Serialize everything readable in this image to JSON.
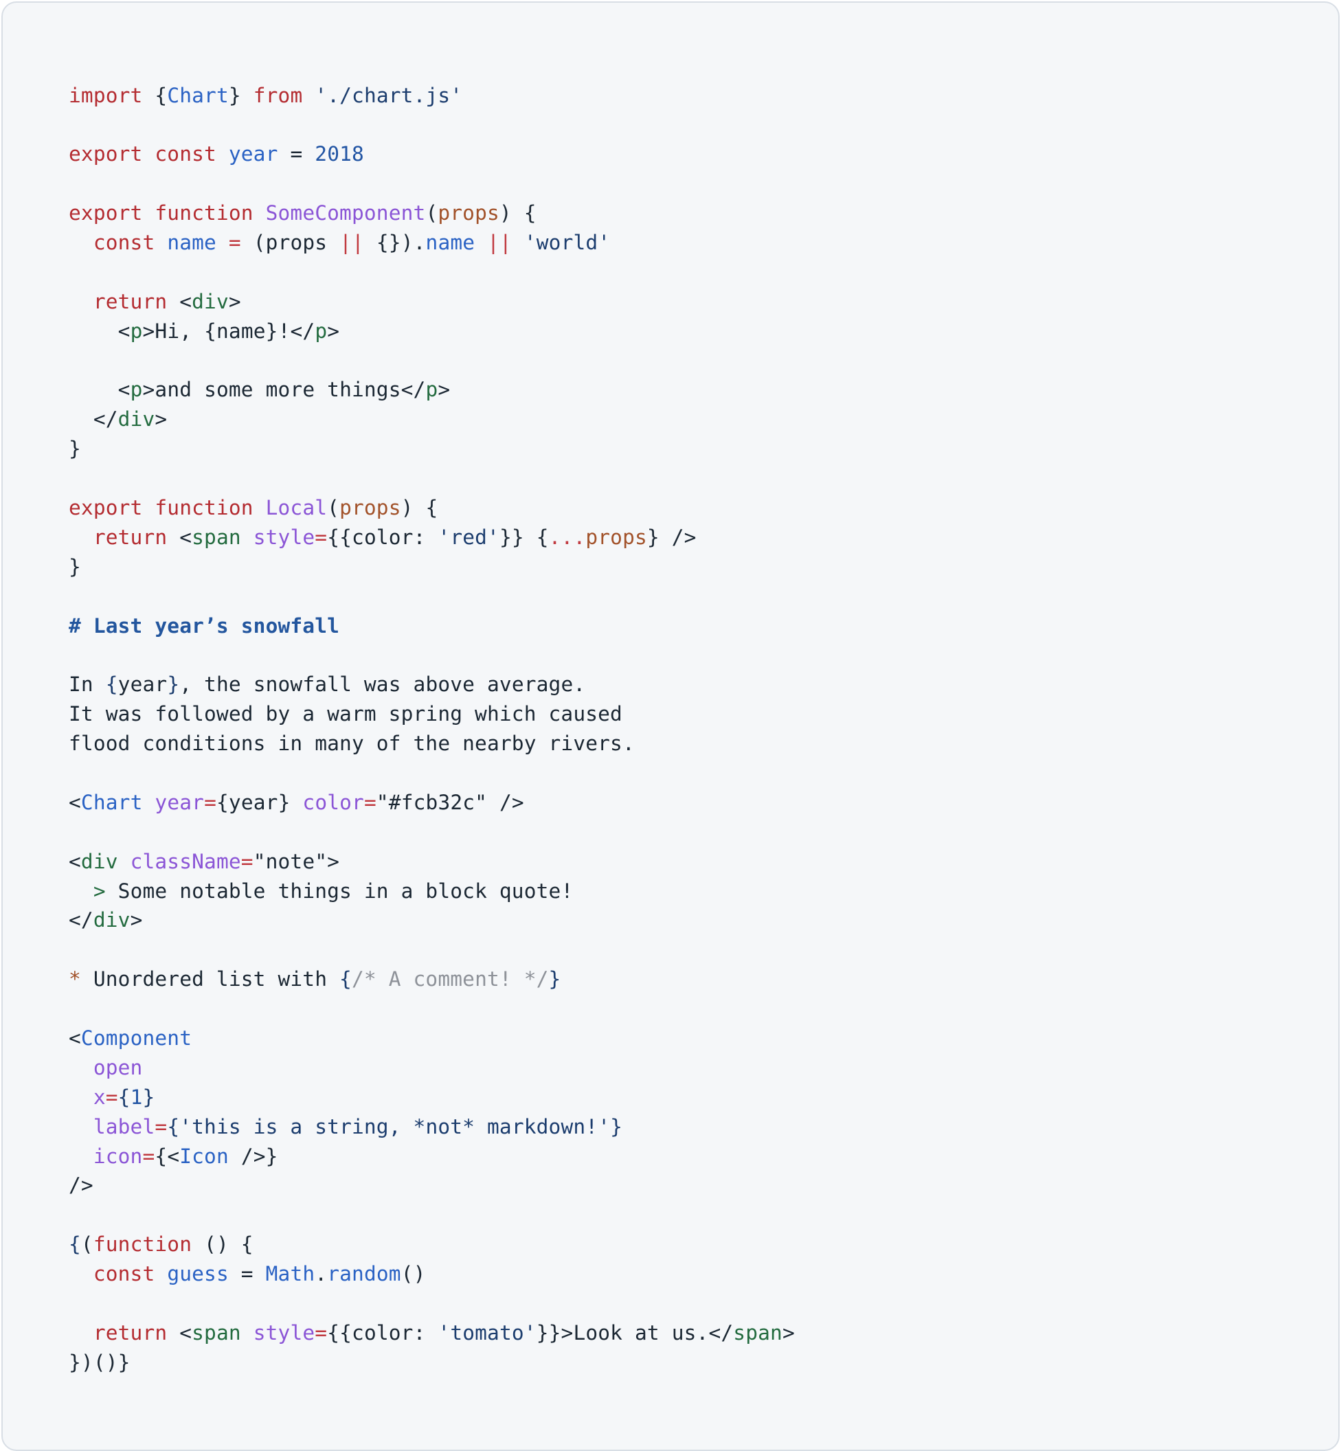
{
  "document": {
    "kind": "mdx-source-code",
    "language": "MDX / JSX",
    "background": "#f5f7f9",
    "border_color": "#d8dee5",
    "default_text_color": "#1b2733"
  },
  "theme": {
    "keyword": "#b42c31",
    "string": "#1c3d6e",
    "number": "#2255a4",
    "variable": "#2a62c4",
    "component": "#8b55d6",
    "parameter": "#a2522a",
    "tag": "#236b3f",
    "component_tag": "#2a62c4",
    "attribute": "#8b55d6",
    "operator": "#c0393f",
    "brace": "#1c3d6e",
    "heading": "#23569e",
    "blockquote": "#236b3f",
    "bullet": "#a2522a",
    "comment": "#8e9299"
  },
  "code": {
    "lines": [
      {
        "n": 1,
        "text": "import {Chart} from './chart.js'"
      },
      {
        "n": 2,
        "text": ""
      },
      {
        "n": 3,
        "text": "export const year = 2018"
      },
      {
        "n": 4,
        "text": ""
      },
      {
        "n": 5,
        "text": "export function SomeComponent(props) {"
      },
      {
        "n": 6,
        "text": "  const name = (props || {}).name || 'world'"
      },
      {
        "n": 7,
        "text": ""
      },
      {
        "n": 8,
        "text": "  return <div>"
      },
      {
        "n": 9,
        "text": "    <p>Hi, {name}!</p>"
      },
      {
        "n": 10,
        "text": ""
      },
      {
        "n": 11,
        "text": "    <p>and some more things</p>"
      },
      {
        "n": 12,
        "text": "  </div>"
      },
      {
        "n": 13,
        "text": "}"
      },
      {
        "n": 14,
        "text": ""
      },
      {
        "n": 15,
        "text": "export function Local(props) {"
      },
      {
        "n": 16,
        "text": "  return <span style={{color: 'red'}} {...props} />"
      },
      {
        "n": 17,
        "text": "}"
      },
      {
        "n": 18,
        "text": ""
      },
      {
        "n": 19,
        "text": "# Last year’s snowfall"
      },
      {
        "n": 20,
        "text": ""
      },
      {
        "n": 21,
        "text": "In {year}, the snowfall was above average."
      },
      {
        "n": 22,
        "text": "It was followed by a warm spring which caused"
      },
      {
        "n": 23,
        "text": "flood conditions in many of the nearby rivers."
      },
      {
        "n": 24,
        "text": ""
      },
      {
        "n": 25,
        "text": "<Chart year={year} color=\"#fcb32c\" />"
      },
      {
        "n": 26,
        "text": ""
      },
      {
        "n": 27,
        "text": "<div className=\"note\">"
      },
      {
        "n": 28,
        "text": "  > Some notable things in a block quote!"
      },
      {
        "n": 29,
        "text": "</div>"
      },
      {
        "n": 30,
        "text": ""
      },
      {
        "n": 31,
        "text": "* Unordered list with {/* A comment! */}"
      },
      {
        "n": 32,
        "text": ""
      },
      {
        "n": 33,
        "text": "<Component"
      },
      {
        "n": 34,
        "text": "  open"
      },
      {
        "n": 35,
        "text": "  x={1}"
      },
      {
        "n": 36,
        "text": "  label={'this is a string, *not* markdown!'}"
      },
      {
        "n": 37,
        "text": "  icon={<Icon />}"
      },
      {
        "n": 38,
        "text": "/>"
      },
      {
        "n": 39,
        "text": ""
      },
      {
        "n": 40,
        "text": "{(function () {"
      },
      {
        "n": 41,
        "text": "  const guess = Math.random()"
      },
      {
        "n": 42,
        "text": ""
      },
      {
        "n": 43,
        "text": "  return <span style={{color: 'tomato'}}>Look at us.</span>"
      },
      {
        "n": 44,
        "text": "})()}"
      }
    ],
    "literals": {
      "module_path": "./chart.js",
      "year_value": "2018",
      "default_name": "world",
      "inline_style_color_1": "red",
      "inline_style_color_2": "tomato",
      "chart_color_hex": "#fcb32c",
      "div_class_name": "note",
      "x_prop_value": "1",
      "label_prop_value": "this is a string, *not* markdown!",
      "span_text": "Look at us."
    },
    "markdown": {
      "heading": "# Last year’s snowfall",
      "paragraph": [
        "In {year}, the snowfall was above average.",
        "It was followed by a warm spring which caused",
        "flood conditions in many of the nearby rivers."
      ],
      "blockquote": "> Some notable things in a block quote!",
      "list_item": "* Unordered list with {/* A comment! */}",
      "comment": "/* A comment! */"
    },
    "identifiers": {
      "imported": "Chart",
      "exported_const": "year",
      "components": [
        "SomeComponent",
        "Local",
        "Chart",
        "Component",
        "Icon"
      ],
      "variables": [
        "name",
        "guess",
        "Math",
        "random",
        "props"
      ],
      "jsx_tags": [
        "div",
        "p",
        "span"
      ],
      "attributes": [
        "style",
        "year",
        "color",
        "className",
        "open",
        "x",
        "label",
        "icon"
      ]
    }
  }
}
